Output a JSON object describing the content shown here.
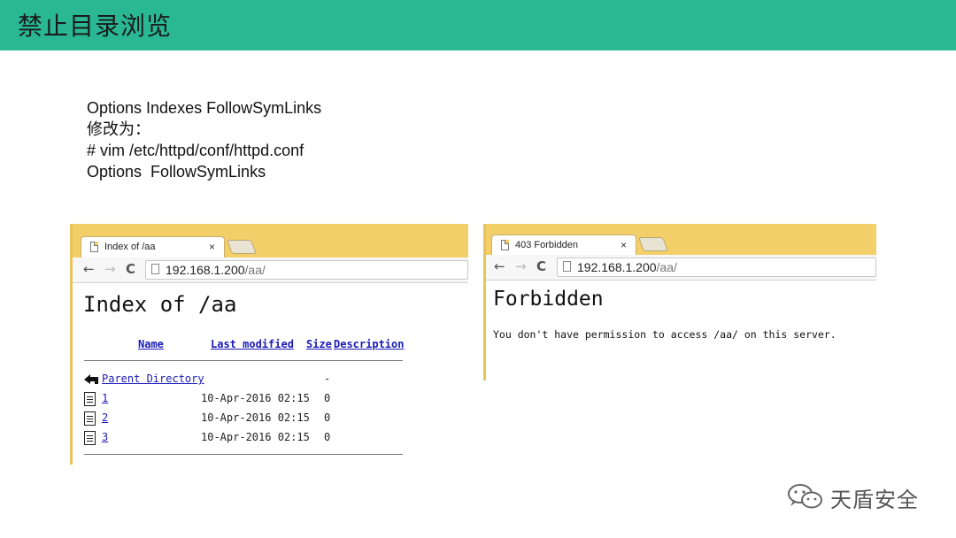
{
  "header": {
    "title": "禁止目录浏览",
    "bg_color": "#2ab894"
  },
  "notes": {
    "line1": "Options Indexes FollowSymLinks",
    "line2": "修改为：",
    "line3": "# vim /etc/httpd/conf/httpd.conf",
    "line4": "Options  FollowSymLinks"
  },
  "browser_index": {
    "tab_title": "Index of /aa",
    "tab_close": "×",
    "url_host": "192.168.1.200",
    "url_path": "/aa/",
    "page_title": "Index of /aa",
    "columns": {
      "name": "Name",
      "last_modified": "Last modified",
      "size": "Size",
      "description": "Description"
    },
    "parent": {
      "label": "Parent Directory",
      "size": "-"
    },
    "rows": [
      {
        "name": "1",
        "modified": "10-Apr-2016 02:15",
        "size": "0"
      },
      {
        "name": "2",
        "modified": "10-Apr-2016 02:15",
        "size": "0"
      },
      {
        "name": "3",
        "modified": "10-Apr-2016 02:15",
        "size": "0"
      }
    ]
  },
  "browser_forbidden": {
    "tab_title": "403 Forbidden",
    "tab_close": "×",
    "url_host": "192.168.1.200",
    "url_path": "/aa/",
    "heading": "Forbidden",
    "message": "You don't have permission to access /aa/ on this server."
  },
  "nav": {
    "back": "←",
    "forward": "→",
    "reload": "C"
  },
  "watermark": {
    "text": "天盾安全"
  },
  "colors": {
    "tabstrip": "#f3cf6a",
    "link": "#1a1ab8"
  }
}
